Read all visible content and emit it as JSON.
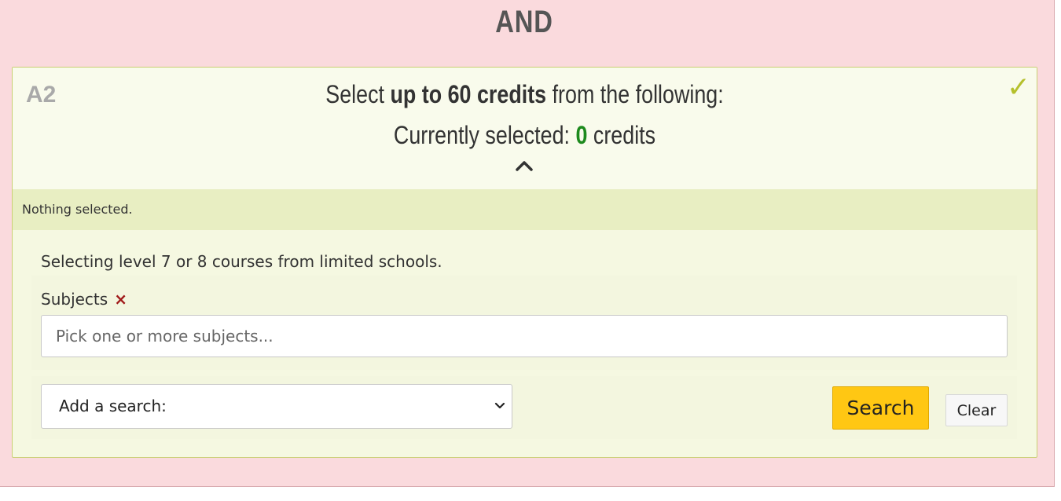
{
  "heading": "AND",
  "requirement": {
    "id": "A2",
    "select_prefix": "Select ",
    "select_bold": "up to 60 credits",
    "select_suffix": " from the following:",
    "current_prefix": "Currently selected: ",
    "current_value": "0",
    "current_suffix": " credits",
    "status_icon": "checkmark-icon",
    "accent_color": "#b5c02c"
  },
  "selection_status": "Nothing selected.",
  "search": {
    "description": "Selecting level 7 or 8 courses from limited schools.",
    "subjects_label": "Subjects",
    "subjects_remove_icon": "×",
    "subjects_placeholder": "Pick one or more subjects...",
    "add_search_label": "Add a search:",
    "search_button": "Search",
    "clear_button": "Clear"
  }
}
